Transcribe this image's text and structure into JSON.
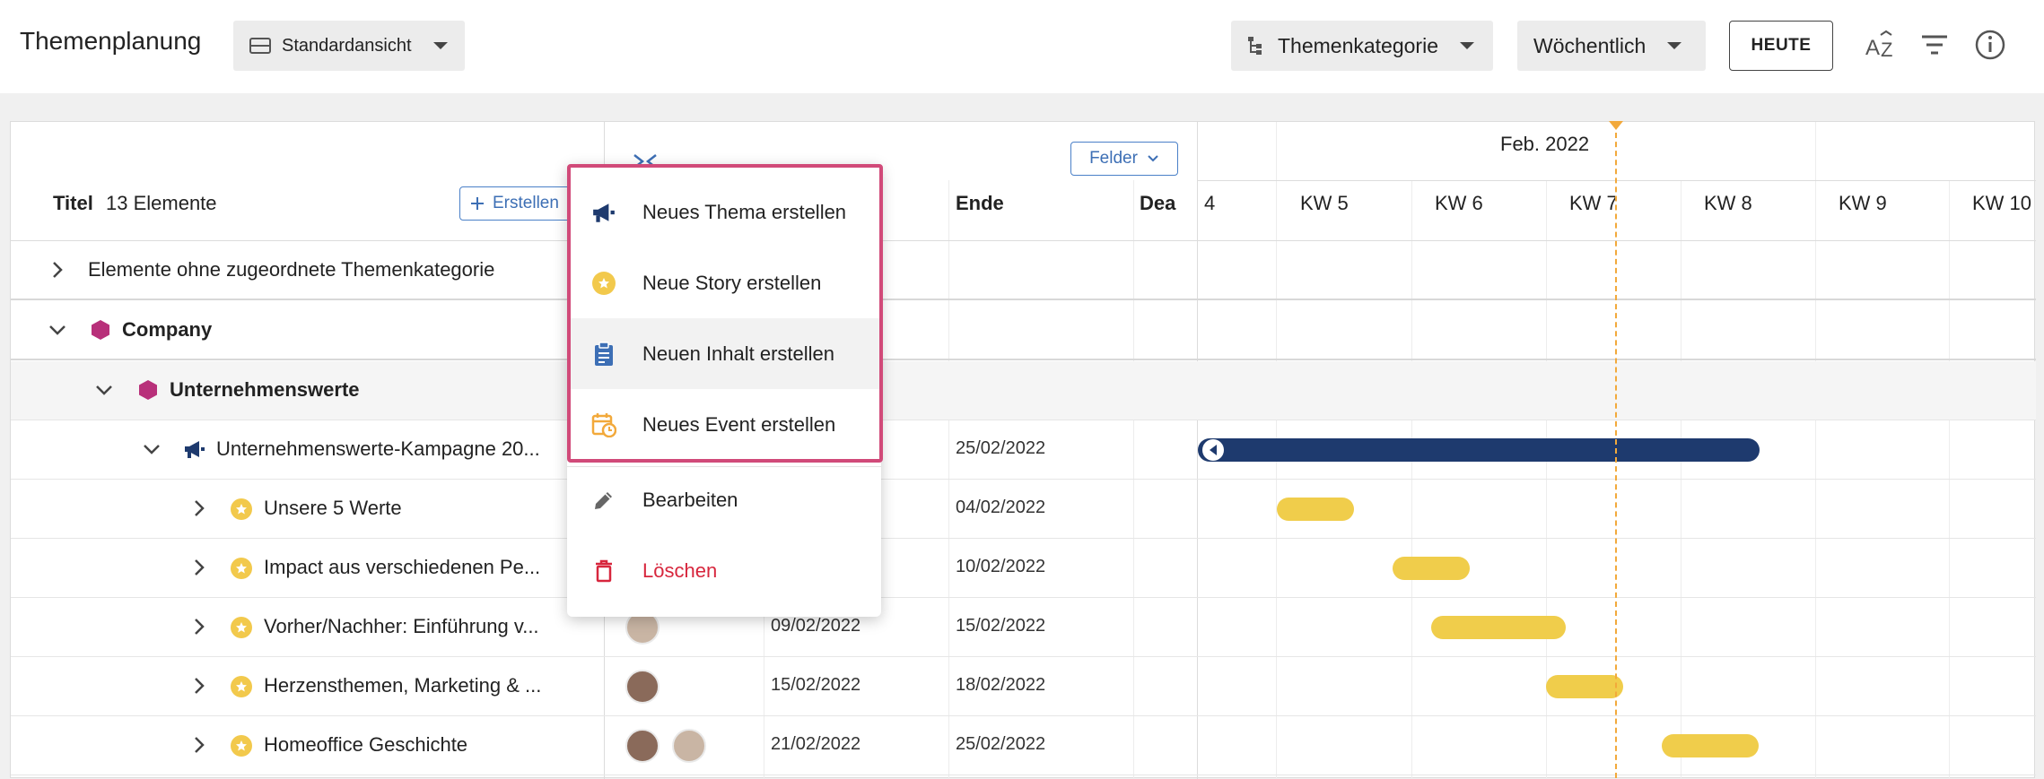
{
  "header": {
    "title": "Themenplanung",
    "view_label": "Standardansicht",
    "grouping_label": "Themenkategorie",
    "period_label": "Wöchentlich",
    "today_label": "HEUTE"
  },
  "table": {
    "title_label": "Titel",
    "count_label": "13 Elemente",
    "create_label": "Erstellen",
    "fields_label": "Felder",
    "end_label": "Ende",
    "dead_label": "Dea"
  },
  "timeline": {
    "month": "Feb. 2022",
    "weeks": [
      "4",
      "KW 5",
      "KW 6",
      "KW 7",
      "KW 8",
      "KW 9",
      "KW 10"
    ]
  },
  "rows": [
    {
      "label": "Elemente ohne zugeordnete Themenkategorie",
      "start": "",
      "end": ""
    },
    {
      "label": "Company",
      "start": "",
      "end": ""
    },
    {
      "label": "Unternehmenswerte",
      "start": "",
      "end": ""
    },
    {
      "label": "Unternehmenswerte-Kampagne 20...",
      "start": "",
      "end": "25/02/2022"
    },
    {
      "label": "Unsere 5 Werte",
      "start": "",
      "end": "04/02/2022"
    },
    {
      "label": "Impact aus verschiedenen Pe...",
      "start": "",
      "end": "10/02/2022"
    },
    {
      "label": "Vorher/Nachher: Einführung v...",
      "start": "09/02/2022",
      "end": "15/02/2022"
    },
    {
      "label": "Herzensthemen, Marketing & ...",
      "start": "15/02/2022",
      "end": "18/02/2022"
    },
    {
      "label": "Homeoffice Geschichte",
      "start": "21/02/2022",
      "end": "25/02/2022"
    }
  ],
  "context_menu": {
    "items": [
      {
        "label": "Neues Thema erstellen",
        "icon": "megaphone-icon"
      },
      {
        "label": "Neue Story erstellen",
        "icon": "star-icon"
      },
      {
        "label": "Neuen Inhalt erstellen",
        "icon": "clipboard-icon"
      },
      {
        "label": "Neues Event erstellen",
        "icon": "calendar-clock-icon"
      },
      {
        "label": "Bearbeiten",
        "icon": "pencil-icon"
      },
      {
        "label": "Löschen",
        "icon": "trash-icon"
      }
    ]
  },
  "colors": {
    "accent_blue": "#3d6fb5",
    "navy": "#1e3a6e",
    "story_yellow": "#f0cd4b",
    "category_magenta": "#b8307a",
    "highlight_pink": "#d14a79",
    "today_orange": "#f2a93b",
    "delete_red": "#d7263d"
  }
}
